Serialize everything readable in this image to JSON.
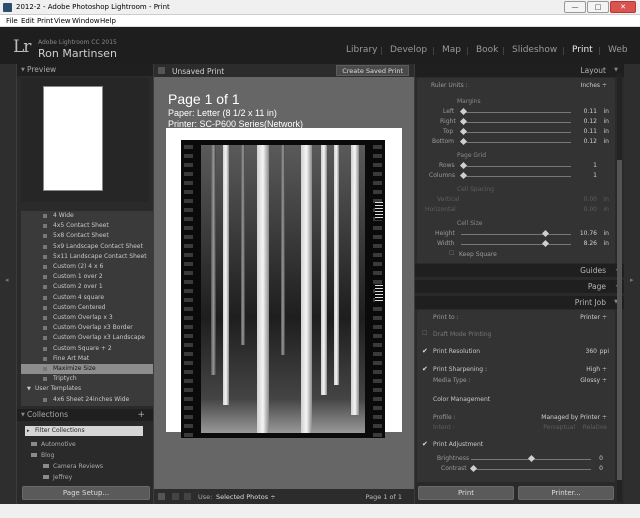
{
  "window": {
    "title": "2012-2 - Adobe Photoshop Lightroom - Print",
    "min": "—",
    "max": "□",
    "close": "✕"
  },
  "menu": [
    "File",
    "Edit",
    "Print",
    "View",
    "Window",
    "Help"
  ],
  "identity": {
    "logo": "Lr",
    "product": "Adobe Lightroom CC 2015",
    "name": "Ron Martinsen",
    "modules": [
      "Library",
      "Develop",
      "Map",
      "Book",
      "Slideshow",
      "Print",
      "Web"
    ],
    "active": "Print"
  },
  "left": {
    "preview_header": "Preview",
    "templates": [
      {
        "label": "4 Wide"
      },
      {
        "label": "4x5 Contact Sheet"
      },
      {
        "label": "5x8 Contact Sheet"
      },
      {
        "label": "5x9 Landscape Contact Sheet"
      },
      {
        "label": "5x11 Landscape Contact Sheet"
      },
      {
        "label": "Custom (2) 4 x 6"
      },
      {
        "label": "Custom 1 over 2"
      },
      {
        "label": "Custom 2 over 1"
      },
      {
        "label": "Custom 4 square"
      },
      {
        "label": "Custom Centered"
      },
      {
        "label": "Custom Overlap x 3"
      },
      {
        "label": "Custom Overlap x3 Border"
      },
      {
        "label": "Custom Overlap x3 Landscape"
      },
      {
        "label": "Custom Square + 2"
      },
      {
        "label": "Fine Art Mat"
      },
      {
        "label": "Maximize Size"
      },
      {
        "label": "Triptych"
      },
      {
        "label": "User Templates"
      },
      {
        "label": "4x6 Sheet 24inches Wide"
      }
    ],
    "collections_header": "Collections",
    "filter": "Filter Collections",
    "collections": [
      "Automotive",
      "Blog",
      "Camera Reviews",
      "Jeffrey"
    ],
    "page_setup": "Page Setup..."
  },
  "center": {
    "unsaved": "Unsaved Print",
    "save_btn": "Create Saved Print",
    "page_title": "Page 1 of 1",
    "paper": "Paper: Letter (8 1/2 x 11 in)",
    "printer": "Printer: SC-P600 Series(Network)",
    "use_label": "Use:",
    "use_value": "Selected Photos ÷",
    "page_count": "Page 1 of 1"
  },
  "right": {
    "layout": "Layout",
    "ruler_units_label": "Ruler Units :",
    "ruler_units_value": "Inches ÷",
    "margins": "Margins",
    "margin_rows": [
      {
        "label": "Left",
        "value": "0.11",
        "unit": "in"
      },
      {
        "label": "Right",
        "value": "0.12",
        "unit": "in"
      },
      {
        "label": "Top",
        "value": "0.11",
        "unit": "in"
      },
      {
        "label": "Bottom",
        "value": "0.12",
        "unit": "in"
      }
    ],
    "page_grid": "Page Grid",
    "grid_rows": [
      {
        "label": "Rows",
        "value": "1"
      },
      {
        "label": "Columns",
        "value": "1"
      }
    ],
    "cell_spacing": "Cell Spacing",
    "spacing_rows": [
      {
        "label": "Vertical",
        "value": "0.00",
        "unit": "in"
      },
      {
        "label": "Horizontal",
        "value": "0.00",
        "unit": "in"
      }
    ],
    "cell_size": "Cell Size",
    "size_rows": [
      {
        "label": "Height",
        "value": "10.76",
        "unit": "in"
      },
      {
        "label": "Width",
        "value": "8.26",
        "unit": "in"
      }
    ],
    "keep_square": "Keep Square",
    "guides": "Guides",
    "page": "Page",
    "print_job": "Print Job",
    "print_to_label": "Print to :",
    "print_to_value": "Printer ÷",
    "draft": "Draft Mode Printing",
    "print_resolution": "Print Resolution",
    "resolution_value": "360",
    "resolution_unit": "ppi",
    "sharpening": "Print Sharpening :",
    "sharpening_value": "High ÷",
    "media_label": "Media Type :",
    "media_value": "Glossy ÷",
    "color_mgmt": "Color Management",
    "profile_label": "Profile :",
    "profile_value": "Managed by Printer ÷",
    "intent_label": "Intent :",
    "intent_perceptual": "Perceptual",
    "intent_relative": "Relative",
    "adjust": "Print Adjustment",
    "brightness": "Brightness",
    "brightness_value": "0",
    "contrast": "Contrast",
    "contrast_value": "0",
    "print_btn": "Print",
    "printer_btn": "Printer..."
  }
}
